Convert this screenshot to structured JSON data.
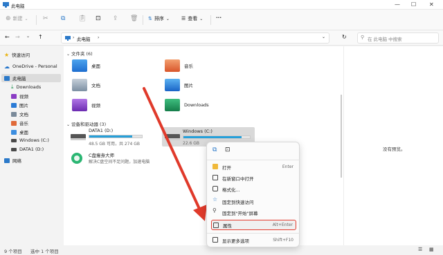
{
  "window": {
    "title": "此电脑"
  },
  "toolbar": {
    "new_label": "新建",
    "sort_label": "排序",
    "view_label": "查看",
    "more_label": "···"
  },
  "address": {
    "path": "此电脑",
    "search_placeholder": "在 此电脑 中搜索"
  },
  "sidebar": {
    "items": [
      {
        "label": "快速访问"
      },
      {
        "label": "OneDrive - Personal"
      },
      {
        "label": "此电脑"
      },
      {
        "label": "Downloads"
      },
      {
        "label": "视频"
      },
      {
        "label": "图片"
      },
      {
        "label": "文档"
      },
      {
        "label": "音乐"
      },
      {
        "label": "桌面"
      },
      {
        "label": "Windows (C:)"
      },
      {
        "label": "DATA1 (D:)"
      },
      {
        "label": "网络"
      }
    ]
  },
  "content": {
    "folders_header": "文件夹 (6)",
    "folders": [
      {
        "label": "桌面"
      },
      {
        "label": "音乐"
      },
      {
        "label": "文档"
      },
      {
        "label": "图片"
      },
      {
        "label": "视频"
      },
      {
        "label": "Downloads"
      }
    ],
    "drives_header": "设备和驱动器 (3)",
    "drives": [
      {
        "label": "DATA1 (D:)",
        "info": "48.5 GB 可用，共 274 GB",
        "used_fraction": 0.82
      },
      {
        "label": "Windows (C:)",
        "info": "22.6 GB",
        "used_fraction": 0.88
      }
    ],
    "app": {
      "label": "C盘瘦身大师",
      "desc": "解决C盘空间不足问题，加速电脑"
    }
  },
  "preview": {
    "text": "没有预览。"
  },
  "status": {
    "count": "9 个项目",
    "selected": "选中 1 个项目"
  },
  "context_menu": {
    "items": [
      {
        "label": "打开",
        "shortcut": "Enter"
      },
      {
        "label": "在新窗口中打开",
        "shortcut": ""
      },
      {
        "label": "格式化...",
        "shortcut": ""
      },
      {
        "label": "固定到快速访问",
        "shortcut": ""
      },
      {
        "label": "固定到\"开始\"屏幕",
        "shortcut": ""
      },
      {
        "label": "属性",
        "shortcut": "Alt+Enter"
      },
      {
        "label": "显示更多选项",
        "shortcut": "Shift+F10"
      }
    ]
  },
  "colors": {
    "accent": "#26a0da",
    "highlight": "#e23b2e",
    "arrow": "#e03a2b"
  }
}
